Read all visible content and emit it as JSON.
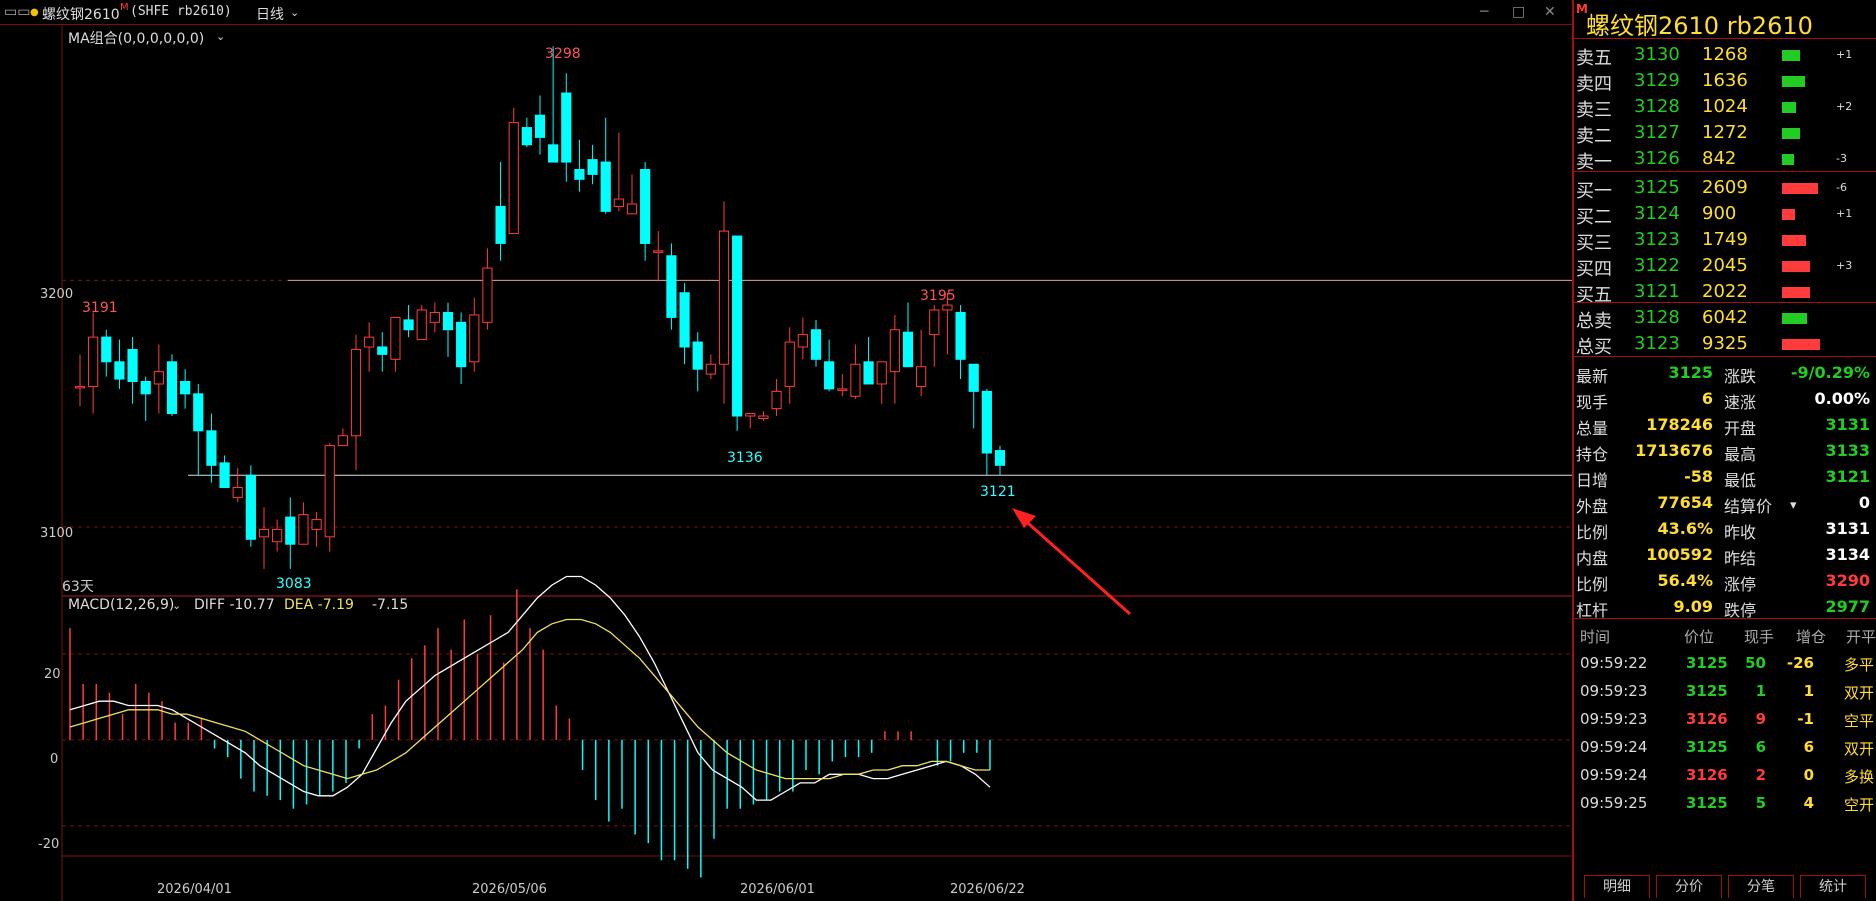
{
  "header": {
    "title": "螺纹钢2610",
    "title_mark": "M",
    "symbol": "(SHFE rb2610)",
    "period": "日线"
  },
  "chart": {
    "ma_label": "MA组合(0,0,0,0,0,0)",
    "days_label": "63天",
    "y_ticks": [
      "3200",
      "3100"
    ],
    "price_labels": {
      "high": "3298",
      "left_high": "3191",
      "low": "3083",
      "mid_low": "3136",
      "right_high": "3195",
      "last_low": "3121"
    },
    "macd_label": "MACD(12,26,9)",
    "diff_label": "DIFF -10.77",
    "dea_label": "DEA -7.19",
    "macd_value": "-7.15",
    "macd_ticks": [
      "20",
      "0",
      "-20"
    ],
    "x_ticks": [
      "2026/04/01",
      "2026/05/06",
      "2026/06/01",
      "2026/06/22"
    ],
    "colors": {
      "up": "#ff3b3b",
      "down": "#00ffff",
      "grid": "#7a1010"
    }
  },
  "chart_data": {
    "type": "candlestick",
    "candles": [
      [
        3157,
        3157,
        3149,
        3170
      ],
      [
        3157,
        3177,
        3146,
        3187
      ],
      [
        3177,
        3167,
        3161,
        3180
      ],
      [
        3167,
        3160,
        3156,
        3176
      ],
      [
        3172,
        3159,
        3150,
        3177
      ],
      [
        3159,
        3154,
        3143,
        3161
      ],
      [
        3158,
        3163,
        3146,
        3174
      ],
      [
        3167,
        3146,
        3145,
        3170
      ],
      [
        3159,
        3154,
        3148,
        3164
      ],
      [
        3154,
        3139,
        3121,
        3158
      ],
      [
        3139,
        3125,
        3118,
        3146
      ],
      [
        3126,
        3116,
        3118,
        3129
      ],
      [
        3112,
        3116,
        3110,
        3124
      ],
      [
        3121,
        3095,
        3092,
        3125
      ],
      [
        3096,
        3099,
        3083,
        3108
      ],
      [
        3094,
        3099,
        3090,
        3103
      ],
      [
        3104,
        3093,
        3083,
        3112
      ],
      [
        3093,
        3105,
        3093,
        3110
      ],
      [
        3099,
        3103,
        3092,
        3106
      ],
      [
        3096,
        3133,
        3090,
        3134
      ],
      [
        3133,
        3137,
        3134,
        3140
      ],
      [
        3137,
        3172,
        3123,
        3178
      ],
      [
        3173,
        3177,
        3163,
        3183
      ],
      [
        3173,
        3170,
        3163,
        3179
      ],
      [
        3168,
        3185,
        3163,
        3185
      ],
      [
        3184,
        3180,
        3177,
        3190
      ],
      [
        3176,
        3188,
        3176,
        3190
      ],
      [
        3183,
        3187,
        3179,
        3191
      ],
      [
        3187,
        3180,
        3169,
        3191
      ],
      [
        3183,
        3165,
        3158,
        3187
      ],
      [
        3167,
        3186,
        3163,
        3193
      ],
      [
        3183,
        3205,
        3180,
        3213
      ],
      [
        3230,
        3215,
        3208,
        3248
      ],
      [
        3219,
        3264,
        3219,
        3270
      ],
      [
        3262,
        3255,
        3254,
        3266
      ],
      [
        3267,
        3258,
        3251,
        3275
      ],
      [
        3255,
        3248,
        3255,
        3295
      ],
      [
        3276,
        3248,
        3240,
        3284
      ],
      [
        3245,
        3241,
        3236,
        3257
      ],
      [
        3249,
        3243,
        3239,
        3255
      ],
      [
        3248,
        3228,
        3227,
        3266
      ],
      [
        3230,
        3233,
        3228,
        3260
      ],
      [
        3227,
        3231,
        3228,
        3243
      ],
      [
        3245,
        3215,
        3208,
        3248
      ],
      [
        3212,
        3212,
        3200,
        3220
      ],
      [
        3210,
        3185,
        3180,
        3215
      ],
      [
        3195,
        3173,
        3166,
        3199
      ],
      [
        3175,
        3164,
        3155,
        3179
      ],
      [
        3162,
        3166,
        3160,
        3170
      ],
      [
        3166,
        3220,
        3150,
        3232
      ],
      [
        3218,
        3145,
        3139,
        3218
      ],
      [
        3145,
        3146,
        3140,
        3144
      ],
      [
        3144,
        3145,
        3143,
        3147
      ],
      [
        3148,
        3155,
        3145,
        3160
      ],
      [
        3157,
        3175,
        3150,
        3181
      ],
      [
        3173,
        3178,
        3168,
        3185
      ],
      [
        3180,
        3168,
        3165,
        3184
      ],
      [
        3167,
        3156,
        3155,
        3176
      ],
      [
        3156,
        3156,
        3153,
        3162
      ],
      [
        3153,
        3166,
        3152,
        3174
      ],
      [
        3167,
        3158,
        3158,
        3177
      ],
      [
        3158,
        3167,
        3150,
        3162
      ],
      [
        3163,
        3180,
        3150,
        3186
      ],
      [
        3179,
        3165,
        3170,
        3191
      ],
      [
        3157,
        3165,
        3153,
        3180
      ],
      [
        3178,
        3188,
        3165,
        3190
      ],
      [
        3188,
        3190,
        3170,
        3195
      ],
      [
        3187,
        3168,
        3160,
        3190
      ],
      [
        3166,
        3155,
        3140,
        3166
      ],
      [
        3155,
        3130,
        3121,
        3156
      ],
      [
        3131,
        3125,
        3121,
        3133
      ]
    ],
    "macd_hist": [
      26,
      13,
      13,
      11,
      6,
      13,
      11,
      9,
      4,
      4,
      5,
      -2,
      -4,
      -9,
      -12,
      -13,
      -14,
      -16,
      -15,
      -13,
      -12,
      -10,
      -2,
      6,
      8,
      14,
      19,
      22,
      26,
      21,
      28,
      20,
      29,
      18,
      35,
      26,
      21,
      8,
      5,
      -7,
      -14,
      -19,
      -16,
      -22,
      -24,
      -28,
      -28,
      -30,
      -32,
      -23,
      -16,
      -16,
      -15,
      -14,
      -12,
      -12,
      -7,
      -8,
      -5,
      -4,
      -4,
      -3,
      2,
      2,
      2,
      0,
      -6,
      -5,
      -3,
      -3,
      -7
    ],
    "diff": [
      7,
      8,
      9,
      9,
      8,
      8,
      8,
      7,
      5,
      3,
      1,
      -1,
      -3,
      -6,
      -8,
      -10,
      -12,
      -13,
      -13,
      -11,
      -8,
      -2,
      4,
      9,
      12,
      15,
      17,
      19,
      21,
      23,
      25,
      29,
      33,
      36,
      38,
      38,
      36,
      33,
      29,
      24,
      18,
      11,
      4,
      -3,
      -7,
      -9,
      -11,
      -14,
      -14,
      -12,
      -10,
      -10,
      -8,
      -8,
      -8,
      -9,
      -9,
      -8,
      -7,
      -6,
      -5,
      -6,
      -8,
      -11
    ],
    "dea": [
      3,
      4,
      5,
      6,
      7,
      7,
      7,
      6,
      6,
      5,
      4,
      3,
      2,
      0,
      -2,
      -4,
      -6,
      -7,
      -8,
      -9,
      -8,
      -7,
      -5,
      -3,
      0,
      3,
      6,
      9,
      12,
      15,
      18,
      21,
      25,
      27,
      28,
      28,
      27,
      25,
      22,
      19,
      15,
      11,
      7,
      3,
      0,
      -3,
      -5,
      -7,
      -8,
      -9,
      -9,
      -9,
      -9,
      -8,
      -8,
      -7,
      -7,
      -6,
      -6,
      -5,
      -5,
      -6,
      -7,
      -7
    ],
    "ylim": [
      3072,
      3304
    ],
    "macd_ylim": [
      -27,
      33
    ]
  },
  "panel": {
    "title": "螺纹钢2610  rb2610",
    "title_mark": "M",
    "asks": [
      {
        "label": "卖五",
        "price": "3130",
        "vol": "1268",
        "delta": "+1",
        "bar": 0.35
      },
      {
        "label": "卖四",
        "price": "3129",
        "vol": "1636",
        "delta": "",
        "bar": 0.45
      },
      {
        "label": "卖三",
        "price": "3128",
        "vol": "1024",
        "delta": "+2",
        "bar": 0.28
      },
      {
        "label": "卖二",
        "price": "3127",
        "vol": "1272",
        "delta": "",
        "bar": 0.35
      },
      {
        "label": "卖一",
        "price": "3126",
        "vol": "842",
        "delta": "-3",
        "bar": 0.24
      }
    ],
    "bids": [
      {
        "label": "买一",
        "price": "3125",
        "vol": "2609",
        "delta": "-6",
        "bar": 0.72
      },
      {
        "label": "买二",
        "price": "3124",
        "vol": "900",
        "delta": "+1",
        "bar": 0.25
      },
      {
        "label": "买三",
        "price": "3123",
        "vol": "1749",
        "delta": "",
        "bar": 0.48
      },
      {
        "label": "买四",
        "price": "3122",
        "vol": "2045",
        "delta": "+3",
        "bar": 0.56
      },
      {
        "label": "买五",
        "price": "3121",
        "vol": "2022",
        "delta": "",
        "bar": 0.56
      }
    ],
    "totals": [
      {
        "label": "总卖",
        "price": "3128",
        "vol": "6042",
        "color": "#22cc22",
        "bar": 0.5
      },
      {
        "label": "总买",
        "price": "3123",
        "vol": "9325",
        "color": "#ff3b3b",
        "bar": 0.75
      }
    ],
    "info": [
      {
        "k1": "最新",
        "v1": "3125",
        "c1": "#22cc22",
        "k2": "涨跌",
        "v2": "-9/0.29%",
        "c2": "#22cc22"
      },
      {
        "k1": "现手",
        "v1": "6",
        "c1": "#ffdd33",
        "k2": "速涨",
        "v2": "0.00%",
        "c2": "#ffffff"
      },
      {
        "k1": "总量",
        "v1": "178246",
        "c1": "#ffdd33",
        "k2": "开盘",
        "v2": "3131",
        "c2": "#22cc22"
      },
      {
        "k1": "持仓",
        "v1": "1713676",
        "c1": "#ffdd33",
        "k2": "最高",
        "v2": "3133",
        "c2": "#22cc22"
      },
      {
        "k1": "日增",
        "v1": "-58",
        "c1": "#ffdd33",
        "k2": "最低",
        "v2": "3121",
        "c2": "#22cc22"
      },
      {
        "k1": "外盘",
        "v1": "77654",
        "c1": "#ffdd33",
        "k2": "结算价",
        "v2": "0",
        "c2": "#ffffff"
      },
      {
        "k1": "比例",
        "v1": "43.6%",
        "c1": "#ffdd33",
        "k2": "昨收",
        "v2": "3131",
        "c2": "#ffffff"
      },
      {
        "k1": "内盘",
        "v1": "100592",
        "c1": "#ffdd33",
        "k2": "昨结",
        "v2": "3134",
        "c2": "#ffffff"
      },
      {
        "k1": "比例",
        "v1": "56.4%",
        "c1": "#ffdd33",
        "k2": "涨停",
        "v2": "3290",
        "c2": "#ff3b3b"
      },
      {
        "k1": "杠杆",
        "v1": "9.09",
        "c1": "#ffdd33",
        "k2": "跌停",
        "v2": "2977",
        "c2": "#22cc22"
      }
    ],
    "trades_header": [
      "时间",
      "价位",
      "现手",
      "增仓",
      "开平"
    ],
    "trades": [
      {
        "time": "09:59:22",
        "price": "3125",
        "qty": "50",
        "chg": "-26",
        "type": "多平",
        "qc": "#22cc22"
      },
      {
        "time": "09:59:23",
        "price": "3125",
        "qty": "1",
        "chg": "1",
        "type": "双开",
        "qc": "#22cc22"
      },
      {
        "time": "09:59:23",
        "price": "3126",
        "qty": "9",
        "chg": "-1",
        "type": "空平",
        "qc": "#ff3b3b"
      },
      {
        "time": "09:59:24",
        "price": "3125",
        "qty": "6",
        "chg": "6",
        "type": "双开",
        "qc": "#22cc22"
      },
      {
        "time": "09:59:24",
        "price": "3126",
        "qty": "2",
        "chg": "0",
        "type": "多换",
        "qc": "#ff3b3b"
      },
      {
        "time": "09:59:25",
        "price": "3125",
        "qty": "5",
        "chg": "4",
        "type": "空开",
        "qc": "#22cc22"
      }
    ],
    "tabs": [
      "明细",
      "分价",
      "分笔",
      "统计"
    ]
  }
}
